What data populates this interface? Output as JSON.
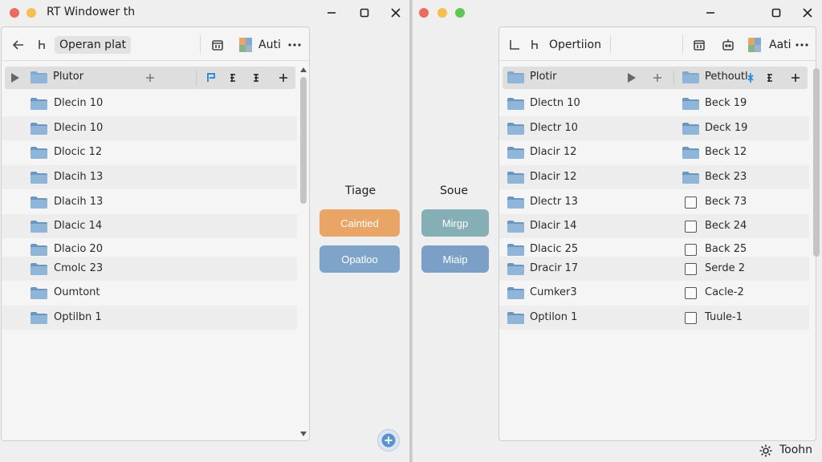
{
  "colors": {
    "close": "#ec6a5e",
    "minimize": "#f4bf4f",
    "maximize": "#61c554",
    "folder": "#7fa9cf",
    "folder_dark": "#6a96c0",
    "orange_button": "#e8a565",
    "blue_button": "#7ea4c9",
    "teal_button": "#86afb5",
    "slate_button": "#7b9fc6"
  },
  "left": {
    "window_title": "RT Windower th",
    "toolbar": {
      "back_icon": "arrow-left-icon",
      "tree_icon": "branch-icon",
      "path_label": "Operan plat",
      "right_label": "Auti",
      "more_icon": "more-icon"
    },
    "header": {
      "label": "Plutor"
    },
    "rows": [
      {
        "label": "Dlecin 10"
      },
      {
        "label": "Dlecin 10"
      },
      {
        "label": "Dlocic 12"
      },
      {
        "label": "Dlacih 13"
      },
      {
        "label": "Dlacih 13"
      },
      {
        "label": "Dlacic 14"
      },
      {
        "label": "Dlacio 20"
      },
      {
        "label": "Cmolc 23"
      },
      {
        "label": "Oumtont"
      },
      {
        "label": "Optilbn 1"
      }
    ]
  },
  "middle": {
    "left_title": "Tiage",
    "right_title": "Soue",
    "btn_orange": "Caintied",
    "btn_blue": "Opatloo",
    "btn_teal": "Mirgp",
    "btn_slate": "Miaip"
  },
  "right": {
    "toolbar": {
      "path_label": "Opertiion",
      "right_label": "Aati"
    },
    "header": {
      "label_left": "Plotir",
      "label_right": "Pethoutl"
    },
    "rows": [
      {
        "left": "Dlectn 10",
        "right": "Beck 19",
        "right_folder": true
      },
      {
        "left": "Dlectr 10",
        "right": "Deck 19",
        "right_folder": true
      },
      {
        "left": "Dlacir 12",
        "right": "Beck 12",
        "right_folder": true
      },
      {
        "left": "Dlacir 12",
        "right": "Beck 23",
        "right_folder": true
      },
      {
        "left": "Dlectr 13",
        "right": "Beck 73",
        "right_folder": false
      },
      {
        "left": "Dlacir 14",
        "right": "Beck 24",
        "right_folder": false
      },
      {
        "left": "Dlacic 25",
        "right": "Back 25",
        "right_folder": false
      },
      {
        "left": "Dracir 17",
        "right": "Serde 2",
        "right_folder": false
      },
      {
        "left": "Cumker3",
        "right": "Cacle-2",
        "right_folder": false
      },
      {
        "left": "Optilon 1",
        "right": "Tuule-1",
        "right_folder": false
      }
    ],
    "bottom_label": "Toohn"
  }
}
